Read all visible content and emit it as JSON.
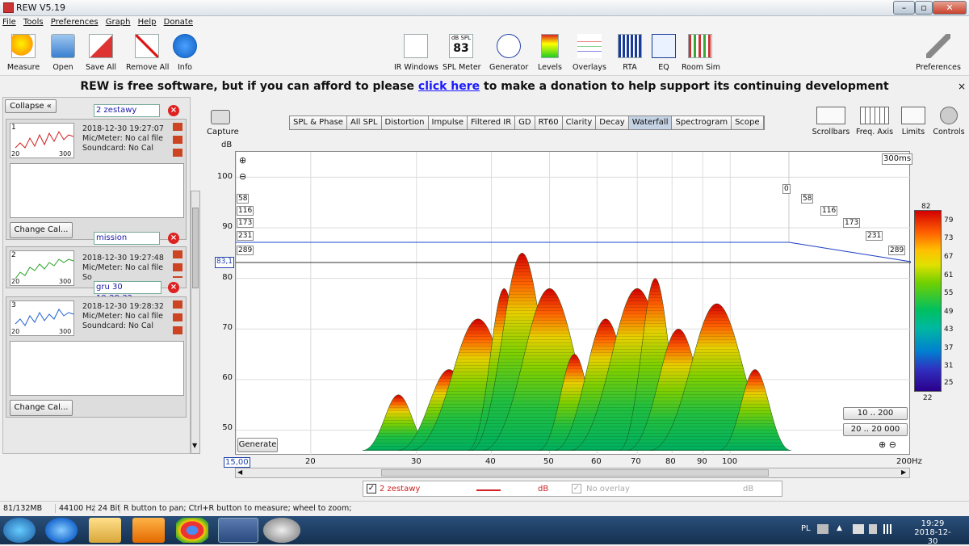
{
  "window": {
    "title": "REW V5.19",
    "minimize": "–",
    "restore": "▫",
    "close": "✕"
  },
  "menu": [
    "File",
    "Tools",
    "Preferences",
    "Graph",
    "Help",
    "Donate"
  ],
  "toolbar_left": [
    {
      "label": "Measure",
      "icon": "measure-icon"
    },
    {
      "label": "Open",
      "icon": "folder-icon"
    },
    {
      "label": "Save All",
      "icon": "save-icon"
    },
    {
      "label": "Remove All",
      "icon": "remove-icon"
    },
    {
      "label": "Info",
      "icon": "info-icon"
    }
  ],
  "toolbar_center": [
    {
      "label": "IR Windows",
      "icon": "ir-windows-icon"
    },
    {
      "label": "SPL Meter",
      "icon": "spl-meter-icon",
      "meter_title": "dB SPL",
      "meter_value": "83"
    },
    {
      "label": "Generator",
      "icon": "generator-icon"
    },
    {
      "label": "Levels",
      "icon": "levels-icon"
    },
    {
      "label": "Overlays",
      "icon": "overlays-icon"
    },
    {
      "label": "RTA",
      "icon": "rta-icon"
    },
    {
      "label": "EQ",
      "icon": "eq-icon"
    },
    {
      "label": "Room Sim",
      "icon": "room-sim-icon"
    }
  ],
  "toolbar_right": {
    "label": "Preferences",
    "icon": "wrench-icon"
  },
  "banner": {
    "before": "REW is free software, but if you can afford to please ",
    "link": "click here",
    "after": " to make a donation to help support its continuing development",
    "close": "×"
  },
  "left_panel": {
    "collapse_label": "Collapse",
    "collapse_icon": "«",
    "change_cal_label": "Change Cal...",
    "measurements": [
      {
        "index": "1",
        "name": "2 zestawy",
        "date": "2018-12-30 19:27:07",
        "mic": "Mic/Meter: No cal file",
        "soundcard": "Soundcard: No Cal",
        "x_left": "20",
        "x_right": "300",
        "color": "#d42020"
      },
      {
        "index": "2",
        "name": "mission",
        "date": "2018-12-30 19:27:48",
        "mic": "Mic/Meter: No cal file",
        "soundcard": "So",
        "x_left": "20",
        "x_right": "300",
        "color": "#20a020"
      },
      {
        "index": "3",
        "name": "gru 30 19:28:32",
        "date": "2018-12-30 19:28:32",
        "mic": "Mic/Meter: No cal file",
        "soundcard": "Soundcard: No Cal",
        "x_left": "20",
        "x_right": "300",
        "color": "#2060d0"
      }
    ]
  },
  "capture": {
    "label": "Capture",
    "unit": "dB"
  },
  "tabs": [
    "SPL & Phase",
    "All SPL",
    "Distortion",
    "Impulse",
    "Filtered IR",
    "GD",
    "RT60",
    "Clarity",
    "Decay",
    "Waterfall",
    "Spectrogram",
    "Scope"
  ],
  "active_tab": "Waterfall",
  "right_tools": [
    {
      "label": "Scrollbars",
      "icon": "scrollbars-icon"
    },
    {
      "label": "Freq. Axis",
      "icon": "freq-axis-icon"
    },
    {
      "label": "Limits",
      "icon": "limits-icon"
    },
    {
      "label": "Controls",
      "icon": "gear-icon"
    }
  ],
  "chart_data": {
    "type": "area",
    "title": "",
    "xlabel": "",
    "ylabel": "dB",
    "x_scale": "log",
    "xlim": [
      15,
      200
    ],
    "ylim": [
      45,
      105
    ],
    "x_ticks": [
      "15,00",
      "20",
      "30",
      "40",
      "50",
      "60",
      "70",
      "80",
      "90",
      "100",
      "200Hz"
    ],
    "y_ticks": [
      "100",
      "90",
      "80",
      "70",
      "60",
      "50"
    ],
    "time_slices": [
      "0",
      "58",
      "116",
      "173",
      "231",
      "289"
    ],
    "depth_label": "300ms",
    "cursor_value": "83,1",
    "colorbar": [
      "82",
      "79",
      "73",
      "67",
      "61",
      "55",
      "49",
      "43",
      "37",
      "31",
      "25",
      "22"
    ],
    "range_buttons": [
      "10 .. 200",
      "20 .. 20 000"
    ],
    "generate_label": "Generate",
    "surface": [
      {
        "x": 28,
        "y": 57
      },
      {
        "x": 34,
        "y": 62
      },
      {
        "x": 38,
        "y": 72
      },
      {
        "x": 42,
        "y": 78
      },
      {
        "x": 45,
        "y": 85
      },
      {
        "x": 50,
        "y": 78
      },
      {
        "x": 55,
        "y": 65
      },
      {
        "x": 62,
        "y": 72
      },
      {
        "x": 70,
        "y": 78
      },
      {
        "x": 75,
        "y": 80
      },
      {
        "x": 82,
        "y": 70
      },
      {
        "x": 95,
        "y": 75
      },
      {
        "x": 110,
        "y": 62
      }
    ]
  },
  "legend": {
    "name": "2 zestawy",
    "unit": "dB",
    "overlay": "No overlay",
    "overlay_unit": "dB"
  },
  "status": {
    "memory": "81/132MB",
    "rate": "44100 Hz",
    "bits": "24 Bit",
    "hint": "R button to pan; Ctrl+R button to measure; wheel to zoom;"
  },
  "taskbar": {
    "lang": "PL",
    "time": "19:29",
    "date": "2018-12-30"
  }
}
